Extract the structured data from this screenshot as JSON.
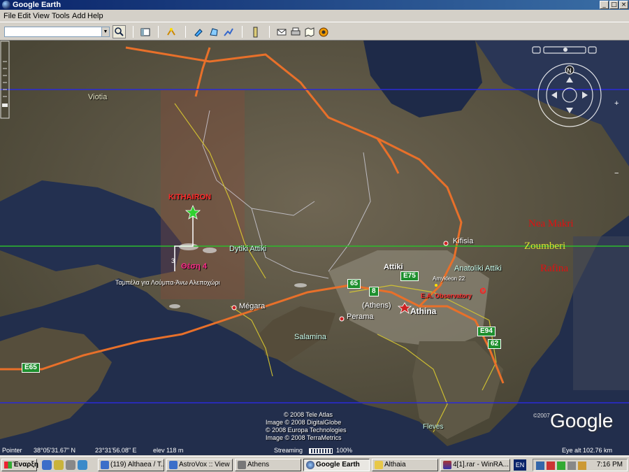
{
  "window": {
    "title": "Google Earth",
    "min": "_",
    "max": "□",
    "close": "×"
  },
  "menu": [
    "File",
    "Edit",
    "View",
    "Tools",
    "Add",
    "Help"
  ],
  "toolbar": {
    "search_value": "",
    "icons": [
      "sidebar-icon",
      "tour-icon",
      "placemark-icon",
      "polygon-icon",
      "path-icon",
      "ruler-icon",
      "email-icon",
      "print-icon",
      "maps-icon",
      "sky-icon"
    ]
  },
  "map": {
    "labels": {
      "viotia": "Viotia",
      "kithairon": "KITHAIRON",
      "dytiki_attiki": "Dytiki Attiki",
      "thesi4": "Θέση 4",
      "tampela": "Ταμπέλα για Λούμπα-Άνω Αλεποχώρι",
      "megara": "Mégara",
      "kifisia": "Kifisia",
      "attiki": "Attiki",
      "anatoliki_attiki": "Anatoliki Attiki",
      "amykleon": "Amykleon 22",
      "athens": "(Athens)",
      "athina": "Athina",
      "perama": "Perama",
      "salamina": "Salamina",
      "ea_observatory": "E.A. Observatory",
      "fleves": "Fleves",
      "nea_makri": "Nea Makri",
      "zoumberi": "Zoumberi",
      "rafina": "Rafina",
      "marker_3": "3",
      "marker_o": "O"
    },
    "shields": {
      "e65": "E65",
      "n65": "65",
      "n8": "8",
      "e75": "E75",
      "e94": "E94",
      "n62": "62"
    },
    "copyright": [
      "© 2008 Tele Atlas",
      "Image © 2008 DigitalGlobe",
      "© 2008 Europa Technologies",
      "Image © 2008 TerraMetrics"
    ],
    "google_logo": "Google",
    "logo_year": "©2007",
    "compass_north": "N",
    "zoom_plus": "+",
    "zoom_minus": "−",
    "colors": {
      "road_orange": "#e8702a",
      "line_blue": "#2a2ad8",
      "line_green": "#2dbb2d",
      "nea_makri": "#e01010",
      "zoumberi": "#d8e030",
      "rafina": "#e01010"
    }
  },
  "status": {
    "pointer_label": "Pointer",
    "lat": "38°05'31.67\" N",
    "lon": "23°31'56.08\" E",
    "elev": "elev  118 m",
    "streaming_label": "Streaming",
    "streaming_pct": "100%",
    "streaming_level": 1.0,
    "eye_alt": "Eye alt  102.76 km"
  },
  "taskbar": {
    "start": "Έναρξη",
    "tasks": [
      {
        "label": "(119) Althaea / T...",
        "active": false
      },
      {
        "label": "AstroVox :: View ...",
        "active": false
      },
      {
        "label": "Athens",
        "active": false
      },
      {
        "label": "Google Earth",
        "active": true
      },
      {
        "label": "Althaia",
        "active": false
      },
      {
        "label": "4[1].rar - WinRA...",
        "active": false
      }
    ],
    "lang": "EN",
    "clock": "7:16 PM"
  }
}
